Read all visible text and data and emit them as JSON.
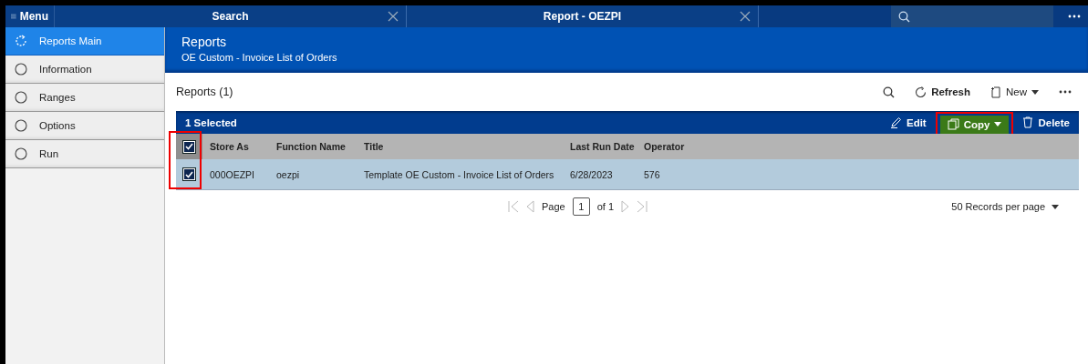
{
  "menu": {
    "label": "Menu"
  },
  "tabs": [
    {
      "label": "Search"
    },
    {
      "label": "Report - OEZPI"
    }
  ],
  "sidebar": {
    "items": [
      {
        "label": "Reports Main",
        "selected": true
      },
      {
        "label": "Information",
        "selected": false
      },
      {
        "label": "Ranges",
        "selected": false
      },
      {
        "label": "Options",
        "selected": false
      },
      {
        "label": "Run",
        "selected": false
      }
    ]
  },
  "header": {
    "title": "Reports",
    "subtitle": "OE Custom - Invoice List of Orders"
  },
  "list": {
    "title": "Reports (1)",
    "refresh": "Refresh",
    "new": "New"
  },
  "selection_bar": {
    "label": "1 Selected",
    "actions": [
      {
        "kind": "edit",
        "label": "Edit",
        "highlighted": false
      },
      {
        "kind": "copy",
        "label": "Copy",
        "highlighted": true
      },
      {
        "kind": "delete",
        "label": "Delete",
        "highlighted": false
      }
    ]
  },
  "table": {
    "all_checked": true,
    "checkbox_column_highlighted": true,
    "columns": [
      "Store As",
      "Function Name",
      "Title",
      "Last Run Date",
      "Operator"
    ],
    "rows": [
      {
        "checked": true,
        "selected": true,
        "cells": [
          "000OEZPI",
          "oezpi",
          "Template OE Custom - Invoice List of Orders",
          "6/28/2023",
          "576"
        ]
      }
    ]
  },
  "pagination": {
    "label": "Page",
    "page": "1",
    "of": "of 1",
    "page_size": "50 Records per page"
  }
}
